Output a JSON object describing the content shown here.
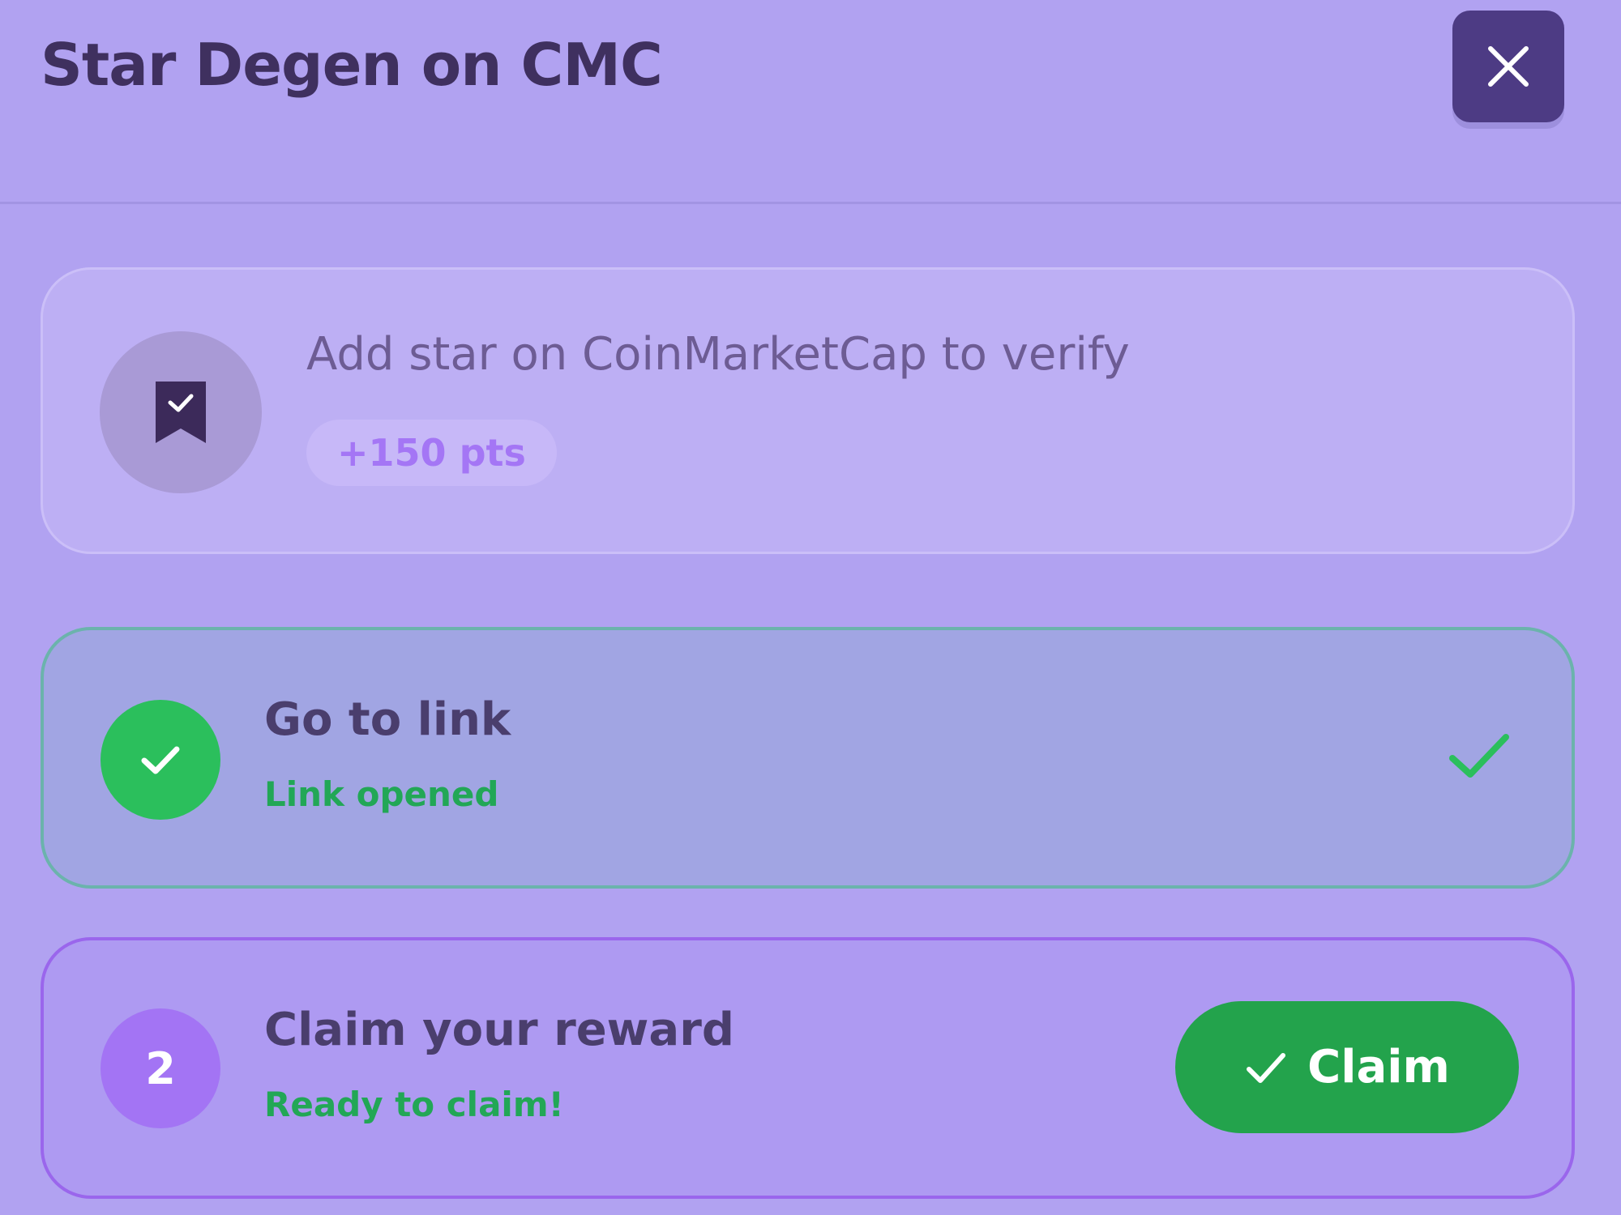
{
  "header": {
    "title": "Star Degen on CMC",
    "close_icon": "close-icon"
  },
  "task": {
    "icon": "bookmark-check-icon",
    "title": "Add star on CoinMarketCap to verify",
    "points": "+150 pts"
  },
  "steps": [
    {
      "status": "done",
      "icon": "check-icon",
      "title": "Go to link",
      "subtitle": "Link opened",
      "trailing_icon": "check-icon"
    },
    {
      "status": "ready",
      "number": "2",
      "title": "Claim your reward",
      "subtitle": "Ready to claim!",
      "button_label": "Claim",
      "button_icon": "check-icon"
    }
  ],
  "colors": {
    "background": "#b1a2f1",
    "accent_green": "#23a34c",
    "accent_purple": "#a374f4",
    "close_button": "#4d3b84"
  }
}
